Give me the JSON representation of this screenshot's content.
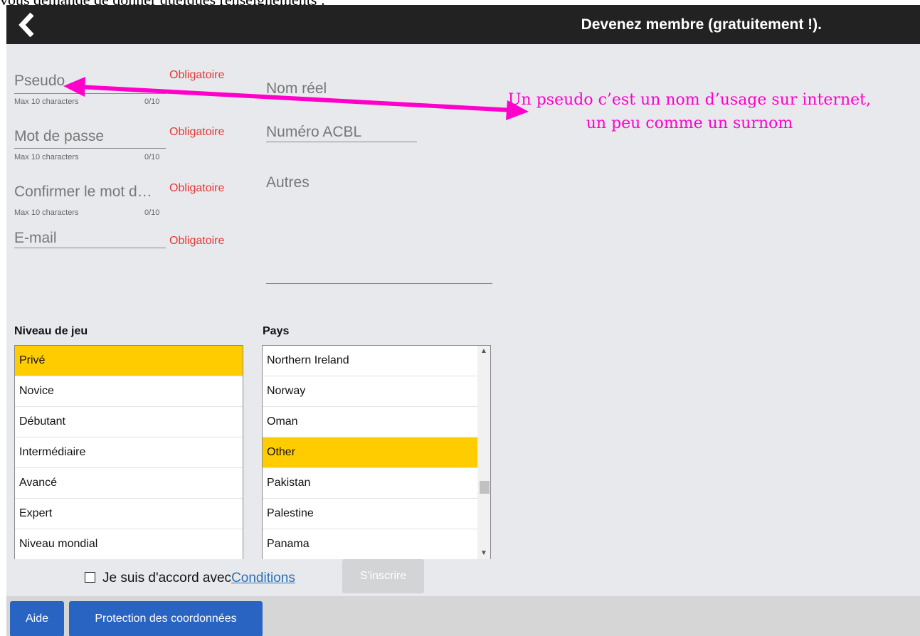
{
  "caption": "vous demande de donner quelques renseignements :",
  "header": {
    "title": "Devenez membre (gratuitement !).",
    "back_icon": "chevron-left-icon"
  },
  "form": {
    "pseudo": {
      "label": "Pseudo",
      "hint": "Max 10 characters",
      "counter": "0/10",
      "required": "Obligatoire"
    },
    "password": {
      "label": "Mot de passe",
      "hint": "Max 10 characters",
      "counter": "0/10",
      "required": "Obligatoire"
    },
    "confirm": {
      "label": "Confirmer le mot d…",
      "hint": "Max 10 characters",
      "counter": "0/10",
      "required": "Obligatoire"
    },
    "email": {
      "label": "E-mail",
      "required": "Obligatoire"
    },
    "real_name": {
      "label": "Nom réel"
    },
    "acbl": {
      "label": "Numéro ACBL"
    },
    "others": {
      "label": "Autres"
    }
  },
  "level": {
    "title": "Niveau de jeu",
    "items": [
      "Privé",
      "Novice",
      "Débutant",
      "Intermédiaire",
      "Avancé",
      "Expert",
      "Niveau mondial"
    ],
    "selected": "Privé"
  },
  "country": {
    "title": "Pays",
    "items": [
      "Northern Ireland",
      "Norway",
      "Oman",
      "Other",
      "Pakistan",
      "Palestine",
      "Panama"
    ],
    "selected": "Other"
  },
  "agreement": {
    "text": "Je suis d'accord avec",
    "link": "Conditions"
  },
  "register_label": "S'inscrire",
  "footer": {
    "help_label": "Aide",
    "privacy_label": "Protection des coordonnées"
  },
  "annotation": "Un pseudo c’est un nom d’usage sur internet, un peu comme un surnom",
  "colors": {
    "header_bg": "#222222",
    "required": "#e53935",
    "selected_row": "#ffcc00",
    "button_blue": "#2a64c3",
    "annotation": "#ff00cc"
  }
}
